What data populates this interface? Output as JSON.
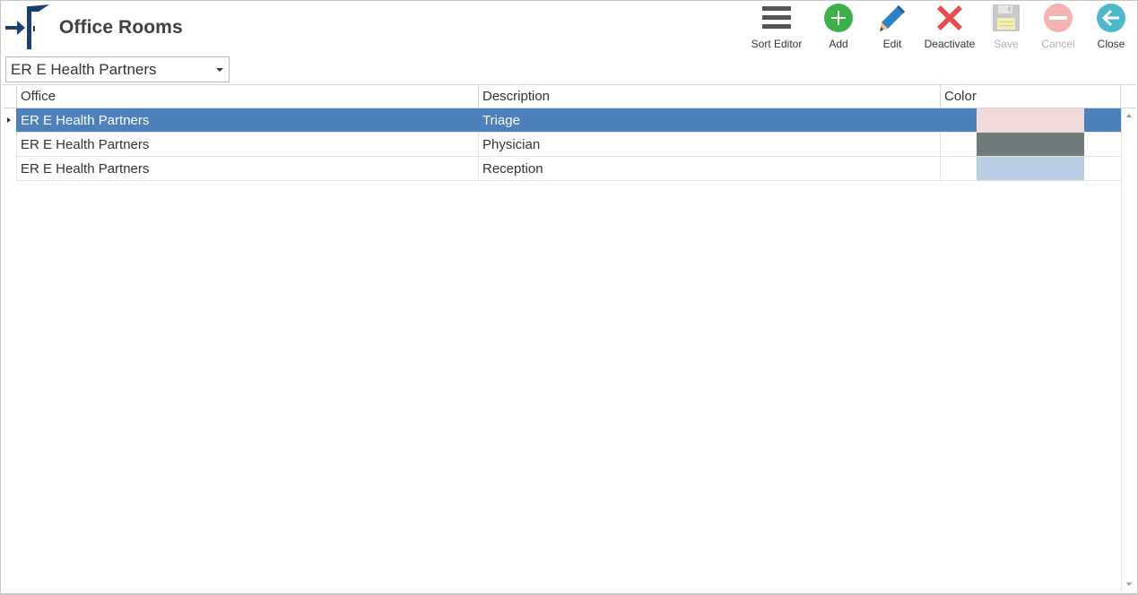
{
  "window": {
    "title": "Office Rooms"
  },
  "toolbar": {
    "sort_editor": "Sort Editor",
    "add": "Add",
    "edit": "Edit",
    "deactivate": "Deactivate",
    "save": "Save",
    "cancel": "Cancel",
    "close": "Close"
  },
  "office_selector": {
    "value": "ER E Health Partners"
  },
  "grid": {
    "columns": [
      "Office",
      "Description",
      "Color"
    ],
    "rows": [
      {
        "office": "ER E Health Partners",
        "description": "Triage",
        "color": "#f0d9d9",
        "selected": true
      },
      {
        "office": "ER E Health Partners",
        "description": "Physician",
        "color": "#6e7b7a",
        "selected": false
      },
      {
        "office": "ER E Health Partners",
        "description": "Reception",
        "color": "#b8cce4",
        "selected": false
      }
    ]
  },
  "colors": {
    "selection": "#4e80bb",
    "add_green": "#3cb14a",
    "edit_blue": "#2e82c6",
    "deactivate_red": "#e84c4c",
    "close_teal": "#4ab8c8",
    "logo_navy": "#1c3f6e"
  },
  "icons": {
    "logo": "office-logo-icon",
    "sort_editor": "hamburger-menu-icon",
    "add": "plus-circle-icon",
    "edit": "pencil-icon",
    "deactivate": "x-mark-icon",
    "save": "floppy-disk-icon",
    "cancel": "minus-circle-icon",
    "close": "arrow-left-circle-icon"
  }
}
